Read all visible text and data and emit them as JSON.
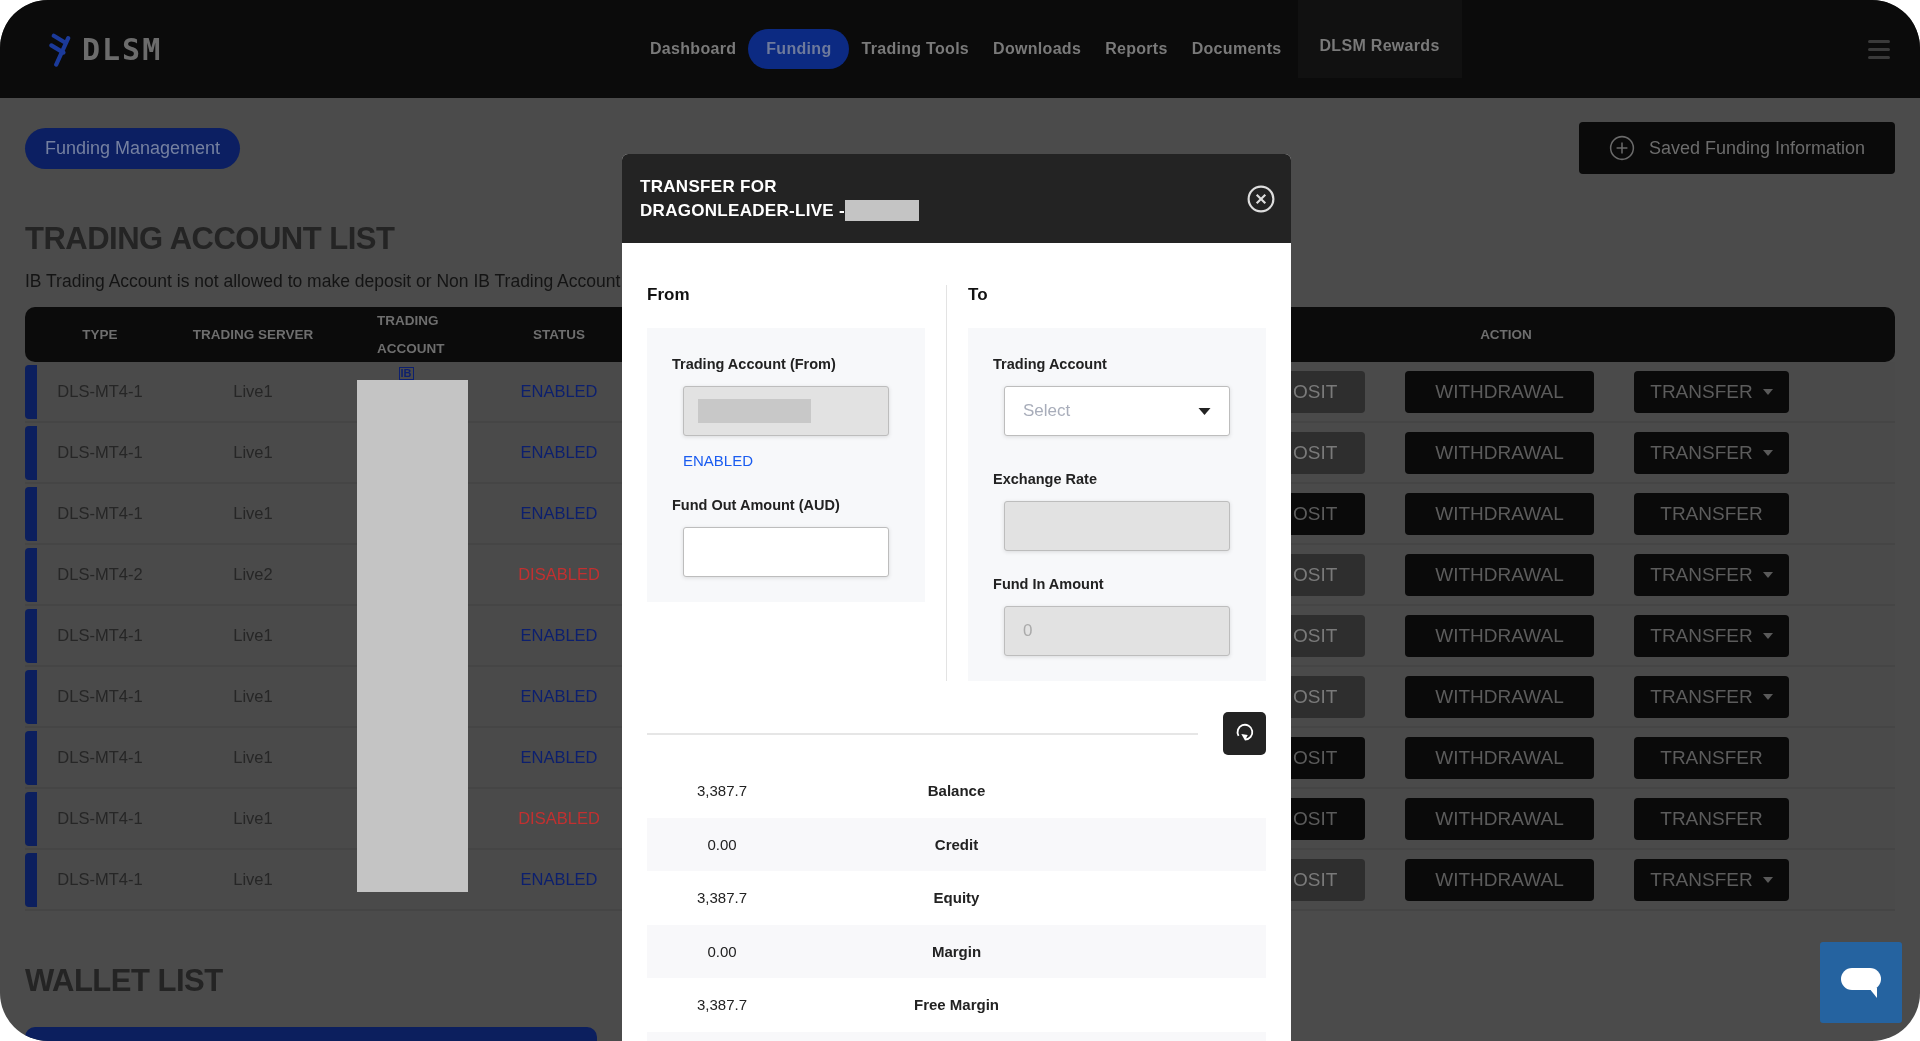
{
  "header": {
    "logo": "DLSM",
    "nav": [
      {
        "label": "Dashboard",
        "selected": false,
        "kind": "plain"
      },
      {
        "label": "Funding",
        "selected": true,
        "kind": "plain"
      },
      {
        "label": "Trading Tools",
        "selected": false,
        "kind": "plain"
      },
      {
        "label": "Downloads",
        "selected": false,
        "kind": "plain"
      },
      {
        "label": "Reports",
        "selected": false,
        "kind": "plain"
      },
      {
        "label": "Documents",
        "selected": false,
        "kind": "plain"
      },
      {
        "label": "DLSM Rewards",
        "selected": false,
        "kind": "boxed"
      }
    ]
  },
  "funding_management_button": "Funding Management",
  "saved_funding_button": "Saved Funding Information",
  "trading_account_list": {
    "title": "TRADING ACCOUNT LIST",
    "notice": "IB Trading Account is not allowed to make deposit or Non IB Trading Account",
    "columns": [
      "TYPE",
      "TRADING SERVER",
      "TRADING ACCOUNT",
      "STATUS",
      "ACTION"
    ],
    "rows": [
      {
        "type": "DLS-MT4-1",
        "server": "Live1",
        "badge": "IB",
        "status": "ENABLED",
        "enabled": true,
        "deposit": "OSIT",
        "deposit_disabled": true,
        "withdrawal": "WITHDRAWAL",
        "transfer": "TRANSFER",
        "transfer_dropdown": true
      },
      {
        "type": "DLS-MT4-1",
        "server": "Live1",
        "status": "ENABLED",
        "enabled": true,
        "deposit": "OSIT",
        "deposit_disabled": true,
        "withdrawal": "WITHDRAWAL",
        "transfer": "TRANSFER",
        "transfer_dropdown": true
      },
      {
        "type": "DLS-MT4-1",
        "server": "Live1",
        "status": "ENABLED",
        "enabled": true,
        "deposit": "OSIT",
        "deposit_disabled": false,
        "withdrawal": "WITHDRAWAL",
        "transfer": "TRANSFER",
        "transfer_dropdown": false
      },
      {
        "type": "DLS-MT4-2",
        "server": "Live2",
        "status": "DISABLED",
        "enabled": false,
        "deposit": "OSIT",
        "deposit_disabled": true,
        "withdrawal": "WITHDRAWAL",
        "transfer": "TRANSFER",
        "transfer_dropdown": true
      },
      {
        "type": "DLS-MT4-1",
        "server": "Live1",
        "status": "ENABLED",
        "enabled": true,
        "deposit": "OSIT",
        "deposit_disabled": true,
        "withdrawal": "WITHDRAWAL",
        "transfer": "TRANSFER",
        "transfer_dropdown": true
      },
      {
        "type": "DLS-MT4-1",
        "server": "Live1",
        "status": "ENABLED",
        "enabled": true,
        "deposit": "OSIT",
        "deposit_disabled": true,
        "withdrawal": "WITHDRAWAL",
        "transfer": "TRANSFER",
        "transfer_dropdown": true
      },
      {
        "type": "DLS-MT4-1",
        "server": "Live1",
        "status": "ENABLED",
        "enabled": true,
        "deposit": "OSIT",
        "deposit_disabled": false,
        "withdrawal": "WITHDRAWAL",
        "transfer": "TRANSFER",
        "transfer_dropdown": false
      },
      {
        "type": "DLS-MT4-1",
        "server": "Live1",
        "status": "DISABLED",
        "enabled": false,
        "deposit": "OSIT",
        "deposit_disabled": false,
        "withdrawal": "WITHDRAWAL",
        "transfer": "TRANSFER",
        "transfer_dropdown": false
      },
      {
        "type": "DLS-MT4-1",
        "server": "Live1",
        "status": "ENABLED",
        "enabled": true,
        "deposit": "OSIT",
        "deposit_disabled": true,
        "withdrawal": "WITHDRAWAL",
        "transfer": "TRANSFER",
        "transfer_dropdown": true
      }
    ]
  },
  "wallet_list": {
    "title": "WALLET LIST"
  },
  "modal": {
    "title": "TRANSFER FOR",
    "subtitle": "DRAGONLEADER-LIVE -",
    "from": {
      "heading": "From",
      "fields": [
        {
          "kind": "input",
          "label": "Trading Account (From)",
          "disabled": true
        },
        {
          "kind": "status",
          "text": "ENABLED"
        },
        {
          "kind": "input",
          "label": "Fund Out Amount (AUD)",
          "disabled": false
        }
      ]
    },
    "to": {
      "heading": "To",
      "fields": [
        {
          "kind": "select",
          "label": "Trading Account",
          "placeholder": "Select"
        },
        {
          "kind": "input",
          "label": "Exchange Rate",
          "disabled": true
        },
        {
          "kind": "input",
          "label": "Fund In Amount",
          "disabled": true,
          "placeholder": "0"
        }
      ]
    },
    "stats": [
      {
        "value": "3,387.7",
        "label": "Balance"
      },
      {
        "value": "0.00",
        "label": "Credit"
      },
      {
        "value": "3,387.7",
        "label": "Equity"
      },
      {
        "value": "0.00",
        "label": "Margin"
      },
      {
        "value": "3,387.7",
        "label": "Free Margin"
      }
    ]
  }
}
